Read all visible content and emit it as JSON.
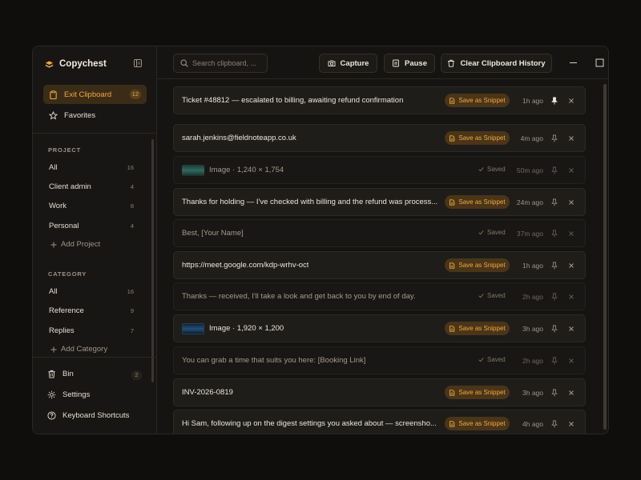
{
  "app": {
    "name": "Copychest"
  },
  "colors": {
    "accent": "#f0a841",
    "accent_bg": "#4a3518",
    "window_bg": "#151412"
  },
  "sidebar": {
    "nav": [
      {
        "label": "Exit Clipboard",
        "count": "12",
        "icon": "clipboard-icon",
        "active": true
      },
      {
        "label": "Favorites",
        "count": "",
        "icon": "star-icon",
        "active": false
      }
    ],
    "project_title": "PROJECT",
    "projects": [
      {
        "label": "All",
        "count": "16"
      },
      {
        "label": "Client admin",
        "count": "4"
      },
      {
        "label": "Work",
        "count": "8"
      },
      {
        "label": "Personal",
        "count": "4"
      }
    ],
    "add_project": "Add Project",
    "category_title": "CATEGORY",
    "categories": [
      {
        "label": "All",
        "count": "16"
      },
      {
        "label": "Reference",
        "count": "9"
      },
      {
        "label": "Replies",
        "count": "7"
      }
    ],
    "add_category": "Add Category",
    "footer": [
      {
        "label": "Bin",
        "count": "2",
        "icon": "trash-icon"
      },
      {
        "label": "Settings",
        "icon": "gear-icon"
      },
      {
        "label": "Keyboard Shortcuts",
        "icon": "help-icon"
      }
    ]
  },
  "toolbar": {
    "search_placeholder": "Search clipboard, ...",
    "capture": "Capture",
    "pause": "Pause",
    "clear": "Clear Clipboard History"
  },
  "items": [
    {
      "text": "Ticket #48812 — escalated to billing, awaiting refund confirmation",
      "type": "text",
      "status": "snippet",
      "time": "1h ago",
      "pinned": true
    },
    {
      "text": "sarah.jenkins@fieldnoteapp.co.uk",
      "type": "text",
      "status": "snippet",
      "time": "4m ago",
      "pinned": false
    },
    {
      "text": "Image · 1,240 × 1,754",
      "type": "image",
      "thumb": "green",
      "status": "saved",
      "time": "50m ago",
      "pinned": false
    },
    {
      "text": "Thanks for holding — I've checked with billing and the refund was process...",
      "type": "text",
      "status": "snippet",
      "time": "24m ago",
      "pinned": false
    },
    {
      "text": "Best, [Your Name]",
      "type": "text",
      "status": "saved",
      "time": "37m ago",
      "pinned": false
    },
    {
      "text": "https://meet.google.com/kdp-wrhv-oct",
      "type": "text",
      "status": "snippet",
      "time": "1h ago",
      "pinned": false
    },
    {
      "text": "Thanks — received, I'll take a look and get back to you by end of day.",
      "type": "text",
      "status": "saved",
      "time": "2h ago",
      "pinned": false
    },
    {
      "text": "Image · 1,920 × 1,200",
      "type": "image",
      "thumb": "blue",
      "status": "snippet",
      "time": "3h ago",
      "pinned": false
    },
    {
      "text": "You can grab a time that suits you here: [Booking Link]",
      "type": "text",
      "status": "saved",
      "time": "2h ago",
      "pinned": false
    },
    {
      "text": "INV-2026-0819",
      "type": "text",
      "status": "snippet",
      "time": "3h ago",
      "pinned": false
    },
    {
      "text": "Hi Sam, following up on the digest settings you asked about — screensho...",
      "type": "text",
      "status": "snippet",
      "time": "4h ago",
      "pinned": false
    }
  ],
  "labels": {
    "save_snippet": "Save as Snippet",
    "saved": "Saved"
  }
}
